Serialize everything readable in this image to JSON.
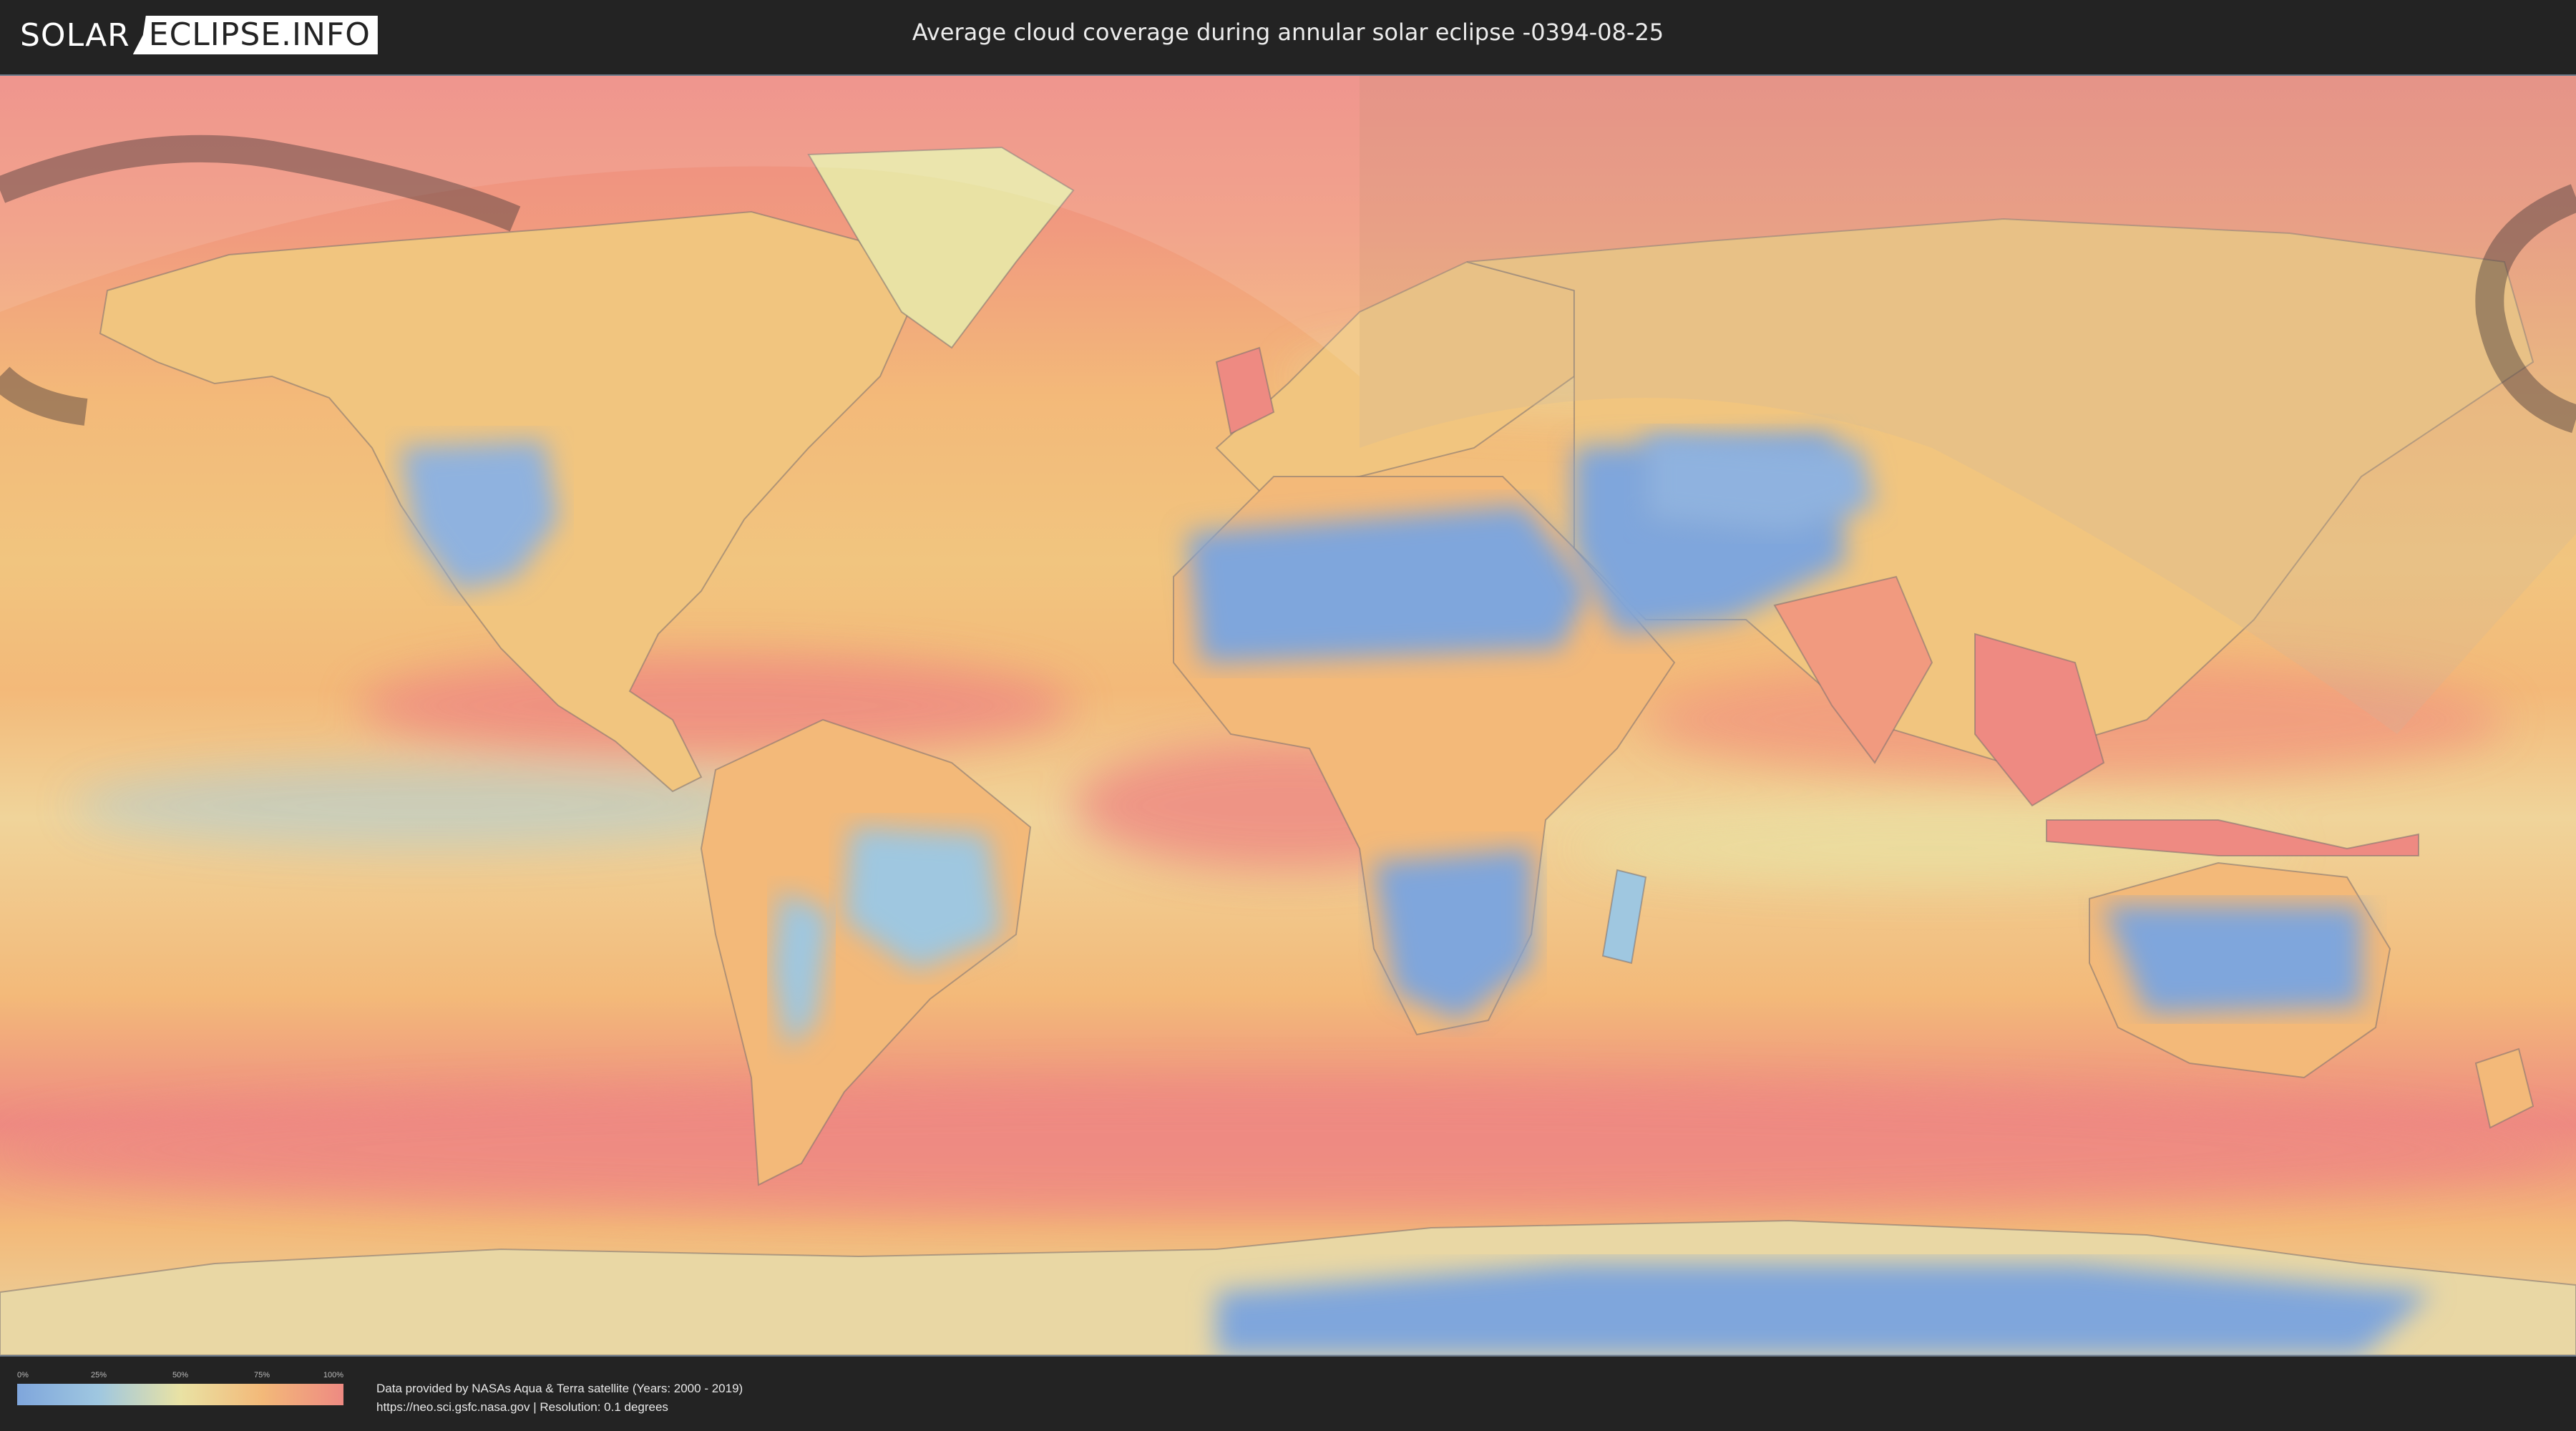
{
  "header": {
    "logo_left": "SOLAR",
    "logo_right": "ECLIPSE.INFO",
    "title": "Average cloud coverage during annular solar eclipse -0394-08-25"
  },
  "map": {
    "projection": "equirectangular",
    "layer": "average cloud coverage",
    "overlay": "annular eclipse path and visibility region",
    "colors": {
      "clear": "#7fa6dc",
      "low": "#9fc7e0",
      "mid": "#e9e2a4",
      "high": "#f3b979",
      "full": "#ee8a82"
    }
  },
  "legend": {
    "ticks": [
      "0%",
      "25%",
      "50%",
      "75%",
      "100%"
    ]
  },
  "footer": {
    "line1": "Data provided by NASAs Aqua & Terra satellite (Years: 2000 - 2019)",
    "line2": "https://neo.sci.gsfc.nasa.gov | Resolution: 0.1 degrees"
  }
}
